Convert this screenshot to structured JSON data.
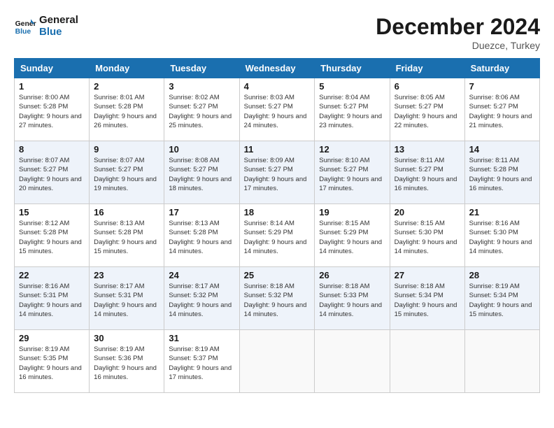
{
  "header": {
    "logo_general": "General",
    "logo_blue": "Blue",
    "month_title": "December 2024",
    "location": "Duezce, Turkey"
  },
  "days_of_week": [
    "Sunday",
    "Monday",
    "Tuesday",
    "Wednesday",
    "Thursday",
    "Friday",
    "Saturday"
  ],
  "weeks": [
    [
      {
        "day": 1,
        "sunrise": "8:00 AM",
        "sunset": "5:28 PM",
        "daylight": "9 hours and 27 minutes."
      },
      {
        "day": 2,
        "sunrise": "8:01 AM",
        "sunset": "5:28 PM",
        "daylight": "9 hours and 26 minutes."
      },
      {
        "day": 3,
        "sunrise": "8:02 AM",
        "sunset": "5:27 PM",
        "daylight": "9 hours and 25 minutes."
      },
      {
        "day": 4,
        "sunrise": "8:03 AM",
        "sunset": "5:27 PM",
        "daylight": "9 hours and 24 minutes."
      },
      {
        "day": 5,
        "sunrise": "8:04 AM",
        "sunset": "5:27 PM",
        "daylight": "9 hours and 23 minutes."
      },
      {
        "day": 6,
        "sunrise": "8:05 AM",
        "sunset": "5:27 PM",
        "daylight": "9 hours and 22 minutes."
      },
      {
        "day": 7,
        "sunrise": "8:06 AM",
        "sunset": "5:27 PM",
        "daylight": "9 hours and 21 minutes."
      }
    ],
    [
      {
        "day": 8,
        "sunrise": "8:07 AM",
        "sunset": "5:27 PM",
        "daylight": "9 hours and 20 minutes."
      },
      {
        "day": 9,
        "sunrise": "8:07 AM",
        "sunset": "5:27 PM",
        "daylight": "9 hours and 19 minutes."
      },
      {
        "day": 10,
        "sunrise": "8:08 AM",
        "sunset": "5:27 PM",
        "daylight": "9 hours and 18 minutes."
      },
      {
        "day": 11,
        "sunrise": "8:09 AM",
        "sunset": "5:27 PM",
        "daylight": "9 hours and 17 minutes."
      },
      {
        "day": 12,
        "sunrise": "8:10 AM",
        "sunset": "5:27 PM",
        "daylight": "9 hours and 17 minutes."
      },
      {
        "day": 13,
        "sunrise": "8:11 AM",
        "sunset": "5:27 PM",
        "daylight": "9 hours and 16 minutes."
      },
      {
        "day": 14,
        "sunrise": "8:11 AM",
        "sunset": "5:28 PM",
        "daylight": "9 hours and 16 minutes."
      }
    ],
    [
      {
        "day": 15,
        "sunrise": "8:12 AM",
        "sunset": "5:28 PM",
        "daylight": "9 hours and 15 minutes."
      },
      {
        "day": 16,
        "sunrise": "8:13 AM",
        "sunset": "5:28 PM",
        "daylight": "9 hours and 15 minutes."
      },
      {
        "day": 17,
        "sunrise": "8:13 AM",
        "sunset": "5:28 PM",
        "daylight": "9 hours and 14 minutes."
      },
      {
        "day": 18,
        "sunrise": "8:14 AM",
        "sunset": "5:29 PM",
        "daylight": "9 hours and 14 minutes."
      },
      {
        "day": 19,
        "sunrise": "8:15 AM",
        "sunset": "5:29 PM",
        "daylight": "9 hours and 14 minutes."
      },
      {
        "day": 20,
        "sunrise": "8:15 AM",
        "sunset": "5:30 PM",
        "daylight": "9 hours and 14 minutes."
      },
      {
        "day": 21,
        "sunrise": "8:16 AM",
        "sunset": "5:30 PM",
        "daylight": "9 hours and 14 minutes."
      }
    ],
    [
      {
        "day": 22,
        "sunrise": "8:16 AM",
        "sunset": "5:31 PM",
        "daylight": "9 hours and 14 minutes."
      },
      {
        "day": 23,
        "sunrise": "8:17 AM",
        "sunset": "5:31 PM",
        "daylight": "9 hours and 14 minutes."
      },
      {
        "day": 24,
        "sunrise": "8:17 AM",
        "sunset": "5:32 PM",
        "daylight": "9 hours and 14 minutes."
      },
      {
        "day": 25,
        "sunrise": "8:18 AM",
        "sunset": "5:32 PM",
        "daylight": "9 hours and 14 minutes."
      },
      {
        "day": 26,
        "sunrise": "8:18 AM",
        "sunset": "5:33 PM",
        "daylight": "9 hours and 14 minutes."
      },
      {
        "day": 27,
        "sunrise": "8:18 AM",
        "sunset": "5:34 PM",
        "daylight": "9 hours and 15 minutes."
      },
      {
        "day": 28,
        "sunrise": "8:19 AM",
        "sunset": "5:34 PM",
        "daylight": "9 hours and 15 minutes."
      }
    ],
    [
      {
        "day": 29,
        "sunrise": "8:19 AM",
        "sunset": "5:35 PM",
        "daylight": "9 hours and 16 minutes."
      },
      {
        "day": 30,
        "sunrise": "8:19 AM",
        "sunset": "5:36 PM",
        "daylight": "9 hours and 16 minutes."
      },
      {
        "day": 31,
        "sunrise": "8:19 AM",
        "sunset": "5:37 PM",
        "daylight": "9 hours and 17 minutes."
      },
      null,
      null,
      null,
      null
    ]
  ]
}
